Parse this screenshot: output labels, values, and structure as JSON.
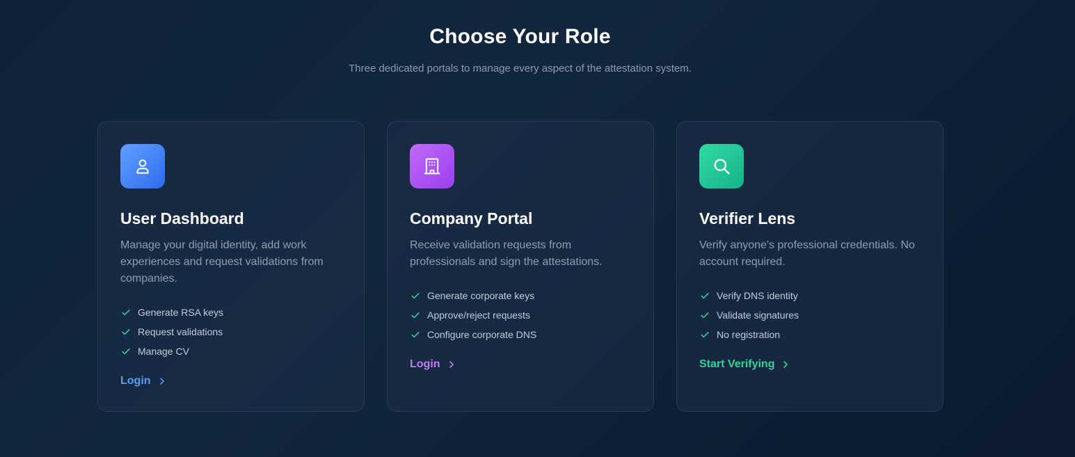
{
  "header": {
    "title": "Choose Your Role",
    "subtitle": "Three dedicated portals to manage every aspect of the attestation system."
  },
  "cards": [
    {
      "icon": "user-icon",
      "accent": "#3b82f6",
      "title": "User Dashboard",
      "description": "Manage your digital identity, add work experiences and request validations from companies.",
      "features": [
        "Generate RSA keys",
        "Request validations",
        "Manage CV"
      ],
      "cta": "Login"
    },
    {
      "icon": "building-icon",
      "accent": "#a855f7",
      "title": "Company Portal",
      "description": "Receive validation requests from professionals and sign the attestations.",
      "features": [
        "Generate corporate keys",
        "Approve/reject requests",
        "Configure corporate DNS"
      ],
      "cta": "Login"
    },
    {
      "icon": "search-icon",
      "accent": "#10b981",
      "title": "Verifier Lens",
      "description": "Verify anyone's professional credentials. No account required.",
      "features": [
        "Verify DNS identity",
        "Validate signatures",
        "No registration"
      ],
      "cta": "Start Verifying"
    }
  ],
  "colors": {
    "check": "#34d399",
    "background": "#0f2238"
  }
}
